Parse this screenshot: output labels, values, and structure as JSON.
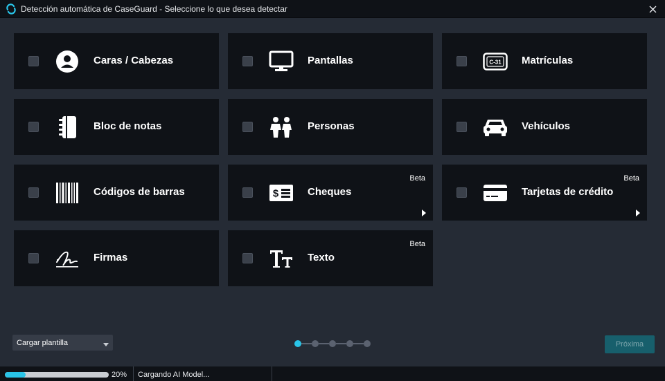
{
  "window": {
    "title": "Detección automática de CaseGuard - Seleccione lo que desea detectar"
  },
  "cards": [
    {
      "label": "Caras / Cabezas",
      "icon": "face-icon",
      "beta": "",
      "checked": false
    },
    {
      "label": "Pantallas",
      "icon": "monitor-icon",
      "beta": "",
      "checked": false
    },
    {
      "label": "Matrículas",
      "icon": "license-plate-icon",
      "beta": "",
      "checked": false
    },
    {
      "label": "Bloc de notas",
      "icon": "notepad-icon",
      "beta": "",
      "checked": false
    },
    {
      "label": "Personas",
      "icon": "people-icon",
      "beta": "",
      "checked": false
    },
    {
      "label": "Vehículos",
      "icon": "car-icon",
      "beta": "",
      "checked": false
    },
    {
      "label": "Códigos de barras",
      "icon": "barcode-icon",
      "beta": "",
      "checked": false
    },
    {
      "label": "Cheques",
      "icon": "check-dollar-icon",
      "beta": "Beta",
      "checked": false
    },
    {
      "label": "Tarjetas de crédito",
      "icon": "credit-card-icon",
      "beta": "Beta",
      "checked": false
    },
    {
      "label": "Firmas",
      "icon": "signature-icon",
      "beta": "",
      "checked": false
    },
    {
      "label": "Texto",
      "icon": "text-icon",
      "beta": "Beta",
      "checked": false
    }
  ],
  "plate_icon_text": "C-31",
  "template_select": {
    "value": "Cargar plantilla"
  },
  "pager": {
    "pages": 5,
    "current": 1
  },
  "next_button": {
    "label": "Próxima"
  },
  "status": {
    "progress": 20,
    "progress_text": "20%",
    "message": "Cargando AI Model..."
  },
  "colors": {
    "accent": "#29c4e8",
    "card_bg": "#0f1217",
    "panel_bg": "#252b35",
    "next_button_bg": "#175f6c"
  }
}
